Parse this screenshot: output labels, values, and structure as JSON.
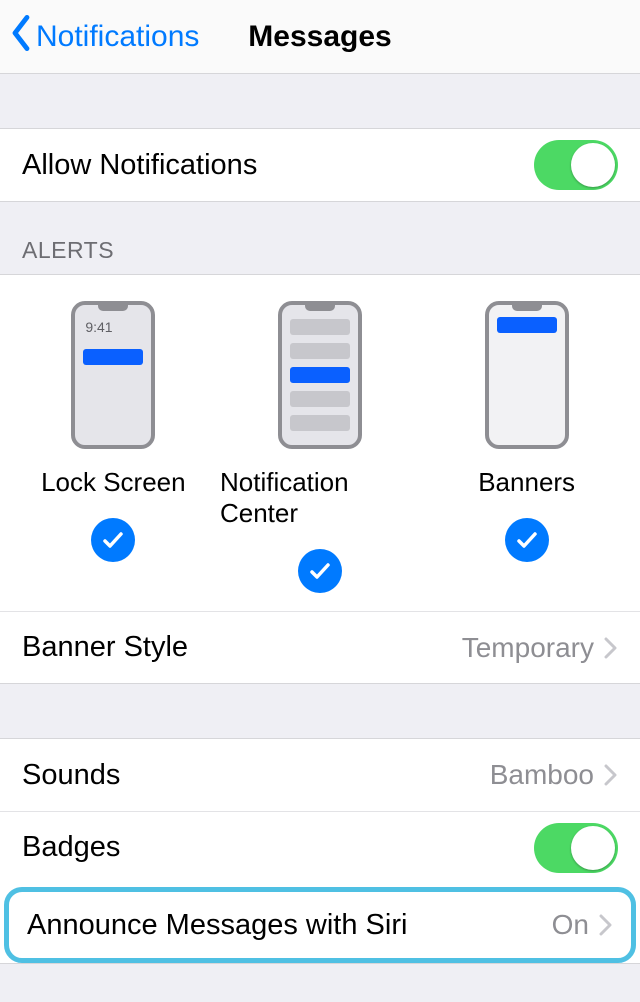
{
  "nav": {
    "back_label": "Notifications",
    "title": "Messages"
  },
  "allow_notifications": {
    "label": "Allow Notifications",
    "on": true
  },
  "alerts": {
    "header": "ALERTS",
    "time_sample": "9:41",
    "items": [
      {
        "label": "Lock Screen",
        "checked": true
      },
      {
        "label": "Notification Center",
        "checked": true
      },
      {
        "label": "Banners",
        "checked": true
      }
    ],
    "banner_style": {
      "label": "Banner Style",
      "value": "Temporary"
    }
  },
  "sounds": {
    "label": "Sounds",
    "value": "Bamboo"
  },
  "badges": {
    "label": "Badges",
    "on": true
  },
  "announce": {
    "label": "Announce Messages with Siri",
    "value": "On"
  }
}
